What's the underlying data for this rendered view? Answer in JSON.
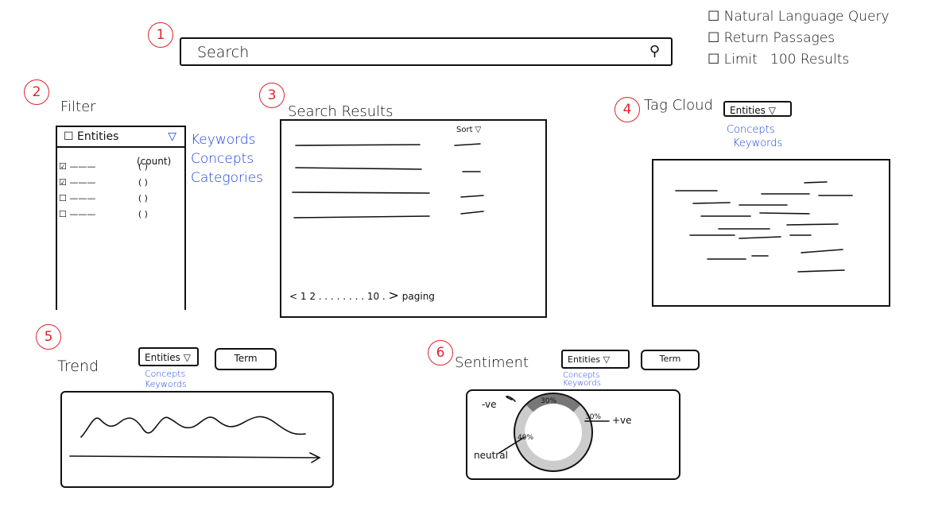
{
  "colors": {
    "annotation": "#e0242a",
    "link": "#1a3fe0",
    "ink": "#111111"
  },
  "markers": [
    "1",
    "2",
    "3",
    "4",
    "5",
    "6"
  ],
  "search": {
    "placeholder": "Search",
    "icon": "search-icon"
  },
  "options": [
    {
      "label": "Natural Language Query",
      "checked": false
    },
    {
      "label": "Return Passages",
      "checked": false
    },
    {
      "label": "Limit   100 Results",
      "checked": false
    }
  ],
  "filter": {
    "title": "Filter",
    "dropdown": "Entities",
    "dropdown_options": [
      "Keywords",
      "Concepts",
      "Categories"
    ],
    "count_header": "(count)",
    "rows": [
      {
        "checked": true,
        "count": "(  )"
      },
      {
        "checked": true,
        "count": "(  )"
      },
      {
        "checked": false,
        "count": "(  )"
      },
      {
        "checked": false,
        "count": "(  )"
      }
    ]
  },
  "results": {
    "title": "Search Results",
    "sort_label": "Sort",
    "paging": {
      "prev": "<",
      "pages": "1 2 . . . . . . . . 10 .",
      "next": ">",
      "label": "paging"
    }
  },
  "tag_cloud": {
    "title": "Tag Cloud",
    "dropdown": "Entities",
    "dropdown_options": [
      "Concepts",
      "Keywords"
    ]
  },
  "trend": {
    "title": "Trend",
    "dropdown": "Entities",
    "dropdown_options": [
      "Concepts",
      "Keywords"
    ],
    "term_button": "Term"
  },
  "sentiment": {
    "title": "Sentiment",
    "dropdown": "Entities",
    "dropdown_options": [
      "Concepts",
      "Keywords"
    ],
    "term_button": "Term",
    "slices": [
      {
        "label": "-ve",
        "value": "30%"
      },
      {
        "label": "+ve",
        "value": "30%"
      },
      {
        "label": "neutral",
        "value": "40%"
      }
    ]
  }
}
